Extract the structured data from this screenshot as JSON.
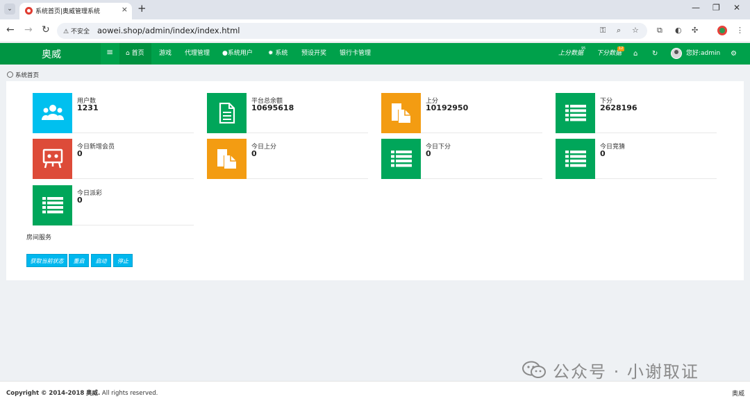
{
  "browser": {
    "tab_title": "系统首页|奥威管理系统",
    "insecure_label": "不安全",
    "url": "aowei.shop/admin/index/index.html"
  },
  "navbar": {
    "brand": "奥威",
    "menu": [
      "首页",
      "游戏",
      "代理管理",
      "系统用户",
      "系统",
      "预设开奖",
      "银行卡管理"
    ],
    "right": {
      "up_data": "上分数据",
      "up_badge": "95",
      "down_data": "下分数据",
      "down_badge": "12",
      "greeting": "您好:admin"
    }
  },
  "breadcrumb": "系统首页",
  "stats": [
    {
      "label": "用户数",
      "value": "1231",
      "color": "#00c0ef",
      "icon": "users-icon"
    },
    {
      "label": "平台总余额",
      "value": "10695618",
      "color": "#00a65a",
      "icon": "document-icon"
    },
    {
      "label": "上分",
      "value": "10192950",
      "color": "#f39c12",
      "icon": "copy-icon"
    },
    {
      "label": "下分",
      "value": "2628196",
      "color": "#00a65a",
      "icon": "list-icon"
    },
    {
      "label": "今日新增会员",
      "value": "0",
      "color": "#dd4b39",
      "icon": "presentation-icon"
    },
    {
      "label": "今日上分",
      "value": "0",
      "color": "#f39c12",
      "icon": "copy-icon"
    },
    {
      "label": "今日下分",
      "value": "0",
      "color": "#00a65a",
      "icon": "list-icon"
    },
    {
      "label": "今日竞猜",
      "value": "0",
      "color": "#00a65a",
      "icon": "list-icon"
    },
    {
      "label": "今日派彩",
      "value": "0",
      "color": "#00a65a",
      "icon": "list-icon"
    }
  ],
  "room_service": {
    "title": "房间服务",
    "buttons": [
      "获取当前状态",
      "重启",
      "启动",
      "停止"
    ]
  },
  "watermark": "公众号 · 小谢取证",
  "footer": {
    "copyright_prefix": "Copyright © 2014-2018",
    "copyright_brand": "奥威.",
    "copyright_suffix": "All rights reserved.",
    "brand": "奥威"
  }
}
